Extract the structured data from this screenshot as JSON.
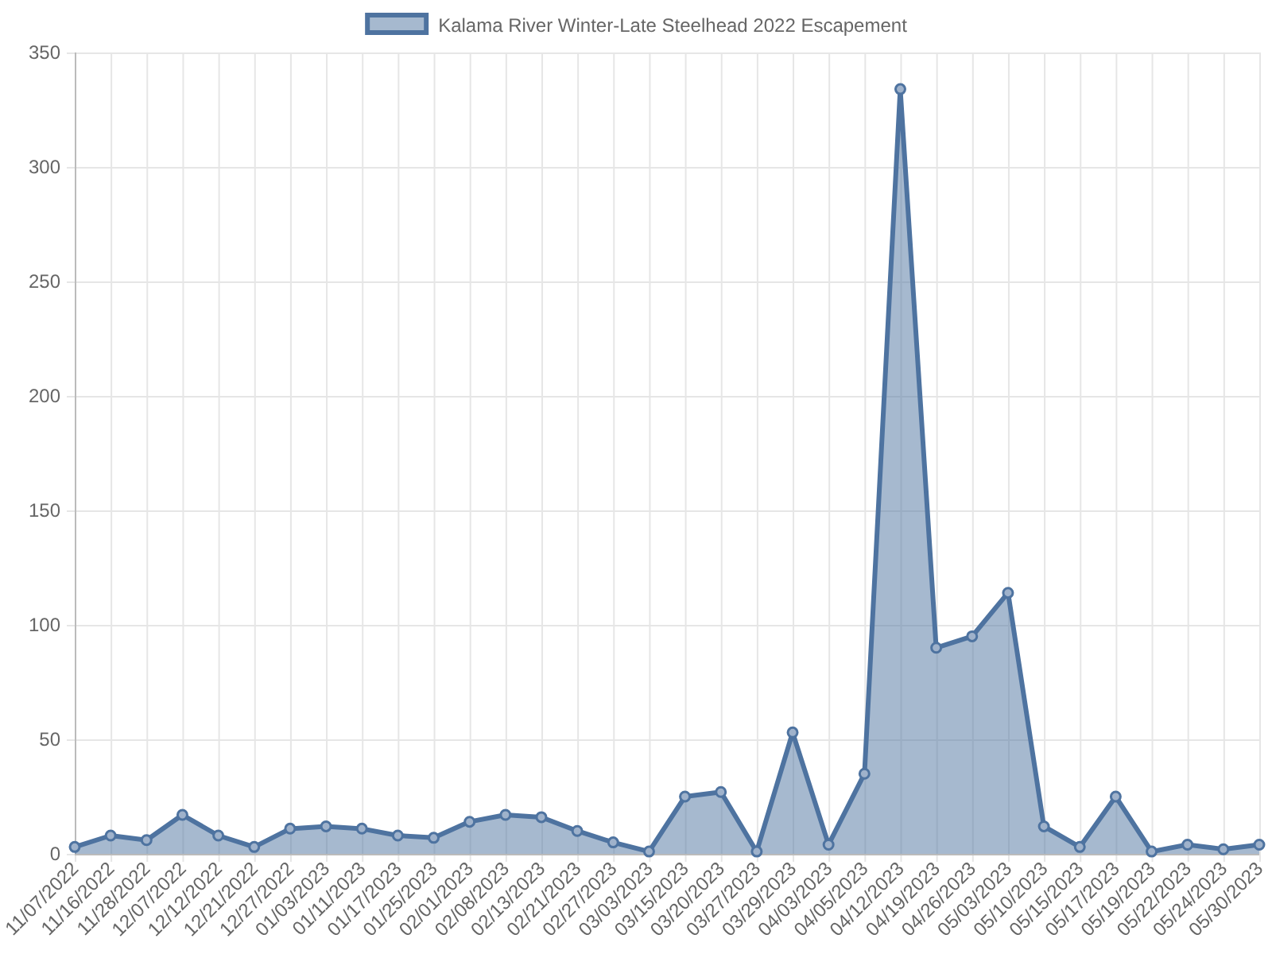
{
  "chart_data": {
    "type": "area",
    "categories": [
      "11/07/2022",
      "11/16/2022",
      "11/28/2022",
      "12/07/2022",
      "12/12/2022",
      "12/21/2022",
      "12/27/2022",
      "01/03/2023",
      "01/11/2023",
      "01/17/2023",
      "01/25/2023",
      "02/01/2023",
      "02/08/2023",
      "02/13/2023",
      "02/21/2023",
      "02/27/2023",
      "03/03/2023",
      "03/15/2023",
      "03/20/2023",
      "03/27/2023",
      "03/29/2023",
      "04/03/2023",
      "04/05/2023",
      "04/12/2023",
      "04/19/2023",
      "04/26/2023",
      "05/03/2023",
      "05/10/2023",
      "05/15/2023",
      "05/17/2023",
      "05/19/2023",
      "05/22/2023",
      "05/24/2023",
      "05/30/2023"
    ],
    "series": [
      {
        "name": "Kalama River Winter-Late Steelhead 2022 Escapement",
        "color": "#4e73a0",
        "values": [
          3,
          8,
          6,
          17,
          8,
          3,
          11,
          12,
          11,
          8,
          7,
          14,
          17,
          16,
          10,
          5,
          1,
          25,
          27,
          1,
          53,
          4,
          35,
          334,
          90,
          95,
          114,
          12,
          3,
          25,
          1,
          4,
          2,
          4
        ]
      }
    ],
    "grid": true,
    "ylim": [
      0,
      350
    ],
    "yticks": [
      0,
      50,
      100,
      150,
      200,
      250,
      300,
      350
    ]
  }
}
